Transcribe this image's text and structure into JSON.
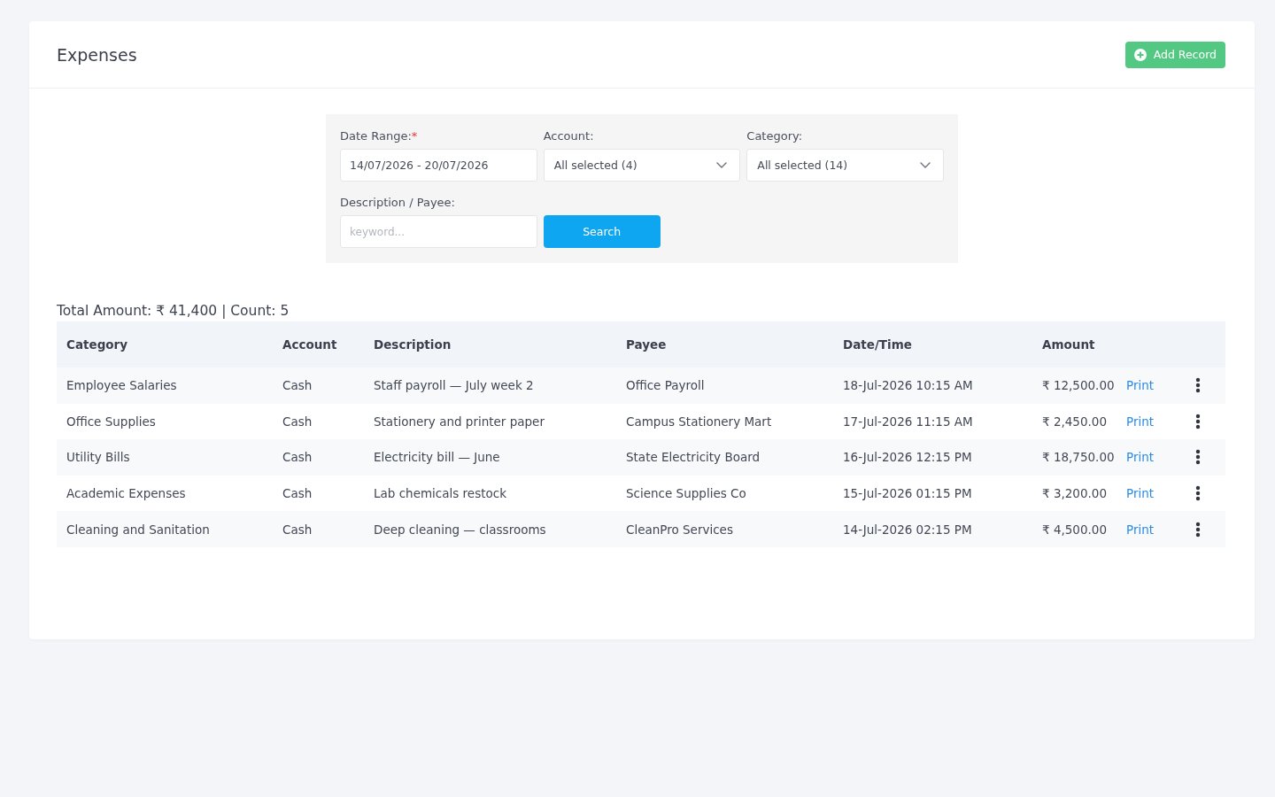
{
  "page": {
    "title": "Expenses",
    "add_button": "Add Record"
  },
  "filters": {
    "date_range": {
      "label": "Date Range:",
      "required_mark": "*",
      "value": "14/07/2026 - 20/07/2026"
    },
    "account": {
      "label": "Account:",
      "value": "All selected (4)"
    },
    "category": {
      "label": "Category:",
      "value": "All selected (14)"
    },
    "keyword": {
      "label": "Description / Payee:",
      "placeholder": "keyword..."
    },
    "search_button": "Search"
  },
  "summary": "Total Amount: ₹ 41,400 | Count: 5",
  "table": {
    "columns": [
      "Category",
      "Account",
      "Description",
      "Payee",
      "Date/Time",
      "Amount"
    ],
    "rows": [
      {
        "category": "Employee Salaries",
        "account": "Cash",
        "description": "Staff payroll — July week 2",
        "payee": "Office Payroll",
        "date_time": "18-Jul-2026 10:15 AM",
        "amount": "₹ 12,500.00",
        "action": "Print"
      },
      {
        "category": "Office Supplies",
        "account": "Cash",
        "description": "Stationery and printer paper",
        "payee": "Campus Stationery Mart",
        "date_time": "17-Jul-2026 11:15 AM",
        "amount": "₹ 2,450.00",
        "action": "Print"
      },
      {
        "category": "Utility Bills",
        "account": "Cash",
        "description": "Electricity bill — June",
        "payee": "State Electricity Board",
        "date_time": "16-Jul-2026 12:15 PM",
        "amount": "₹ 18,750.00",
        "action": "Print"
      },
      {
        "category": "Academic Expenses",
        "account": "Cash",
        "description": "Lab chemicals restock",
        "payee": "Science Supplies Co",
        "date_time": "15-Jul-2026 01:15 PM",
        "amount": "₹ 3,200.00",
        "action": "Print"
      },
      {
        "category": "Cleaning and Sanitation",
        "account": "Cash",
        "description": "Deep cleaning — classrooms",
        "payee": "CleanPro Services",
        "date_time": "14-Jul-2026 02:15 PM",
        "amount": "₹ 4,500.00",
        "action": "Print"
      }
    ]
  }
}
